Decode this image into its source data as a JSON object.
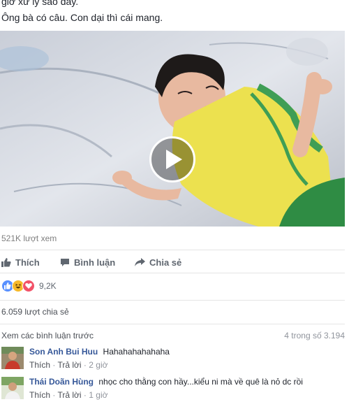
{
  "post": {
    "line1": "giờ xử lý sao đây.",
    "line2": "Ông bà có câu. Con dại thì cái mang."
  },
  "video": {
    "play_icon": "play-icon"
  },
  "stats": {
    "views": "521K lượt xem"
  },
  "actions": {
    "like": "Thích",
    "comment": "Bình luận",
    "share": "Chia sẻ"
  },
  "reactions": {
    "types": [
      "like",
      "haha",
      "love"
    ],
    "colors": {
      "like": "#5890ff",
      "haha": "#f7b928",
      "love": "#f25268"
    },
    "count": "9,2K"
  },
  "shares": {
    "text": "6.059 lượt chia sẻ"
  },
  "comments_header": {
    "view_previous": "Xem các bình luận trước",
    "count": "4 trong số 3.194"
  },
  "comments": [
    {
      "name": "Son Anh Bui Huu",
      "text": "Hahahahahahaha",
      "like": "Thích",
      "reply": "Trả lời",
      "time": "2 giờ"
    },
    {
      "name": "Thái Doãn Hùng",
      "text": "nhọc cho thằng con hầy...kiểu ni mà về quê là nỏ dc rồi",
      "like": "Thích",
      "reply": "Trả lời",
      "time": "1 giờ"
    }
  ],
  "colors": {
    "link": "#365899",
    "muted": "#90949c",
    "action": "#606770"
  }
}
